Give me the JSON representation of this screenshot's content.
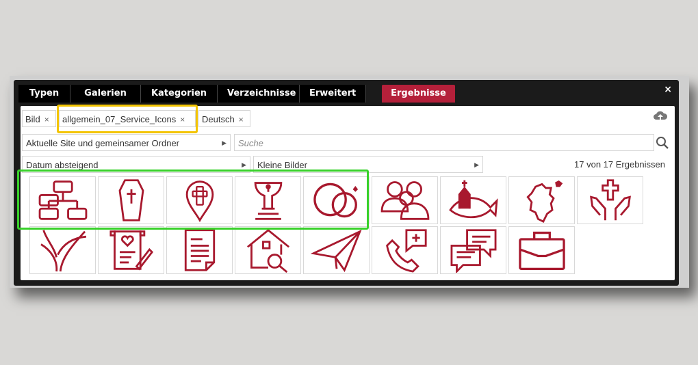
{
  "tabs": [
    {
      "label": "Typen"
    },
    {
      "label": "Galerien"
    },
    {
      "label": "Kategorien"
    },
    {
      "label": "Verzeichnisse"
    },
    {
      "label": "Erweitert"
    }
  ],
  "results_tab": {
    "label": "Ergebnisse",
    "color": "#b4203a"
  },
  "close_label": "×",
  "filters": [
    {
      "label": "Bild",
      "remove": "×"
    },
    {
      "label": "allgemein_07_Service_Icons",
      "remove": "×"
    },
    {
      "label": "Deutsch",
      "remove": "×"
    }
  ],
  "scope_select": {
    "value": "Aktuelle Site und gemeinsamer Ordner"
  },
  "search": {
    "placeholder": "Suche"
  },
  "sort_select": {
    "value": "Datum absteigend"
  },
  "size_select": {
    "value": "Kleine Bilder"
  },
  "result_count": "17 von 17 Ergebnissen",
  "icon_color": "#a8192e",
  "highlight_colors": {
    "filter": "#f3c400",
    "icons": "#38d12a"
  },
  "icons": [
    {
      "name": "org-chart-icon"
    },
    {
      "name": "coffin-icon"
    },
    {
      "name": "cross-location-pin-icon"
    },
    {
      "name": "baptismal-font-icon"
    },
    {
      "name": "wedding-rings-icon"
    },
    {
      "name": "people-group-icon"
    },
    {
      "name": "church-fish-icon"
    },
    {
      "name": "region-map-icon"
    },
    {
      "name": "praying-hands-cross-icon"
    },
    {
      "name": "road-fork-icon"
    },
    {
      "name": "document-heart-pen-icon"
    },
    {
      "name": "document-list-icon"
    },
    {
      "name": "house-magnifier-icon"
    },
    {
      "name": "paper-plane-icon"
    },
    {
      "name": "phone-plus-icon"
    },
    {
      "name": "chat-bubbles-icon"
    },
    {
      "name": "briefcase-icon"
    }
  ]
}
